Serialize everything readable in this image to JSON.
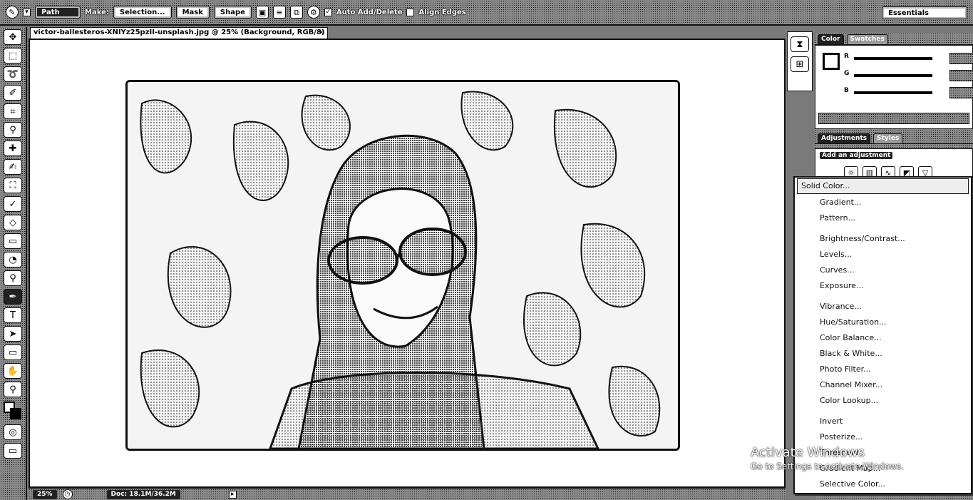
{
  "options_bar": {
    "mode_selected": "Path",
    "make_label": "Make:",
    "selection_button": "Selection...",
    "mask_button": "Mask",
    "shape_button": "Shape",
    "auto_add_delete": "Auto Add/Delete",
    "auto_add_delete_checked": true,
    "align_edges": "Align Edges",
    "align_edges_checked": false,
    "workspace": "Essentials"
  },
  "document": {
    "tab_title": "victor-ballesteros-XNIYz25pzII-unsplash.jpg @ 25% (Background, RGB/8)",
    "close": "×"
  },
  "status_bar": {
    "zoom": "25%",
    "doc_size": "Doc: 18.1M/36.2M"
  },
  "color_panel": {
    "tabs": [
      "Color",
      "Swatches"
    ],
    "channels": [
      "R",
      "G",
      "B"
    ]
  },
  "adjustments_panel": {
    "tabs": [
      "Adjustments",
      "Styles"
    ],
    "add_label": "Add an adjustment"
  },
  "dropdown": {
    "items": [
      "Solid Color...",
      "Gradient...",
      "Pattern...",
      "Brightness/Contrast...",
      "Levels...",
      "Curves...",
      "Exposure...",
      "Vibrance...",
      "Hue/Saturation...",
      "Color Balance...",
      "Black & White...",
      "Photo Filter...",
      "Channel Mixer...",
      "Color Lookup...",
      "Invert",
      "Posterize...",
      "Threshold",
      "Gradient Map...",
      "Selective Color..."
    ],
    "selected": "Solid Color..."
  },
  "watermark": {
    "line1": "Activate Windows",
    "line2": "Go to Settings to activate Windows."
  },
  "colors": {
    "ink": "#111111",
    "menu_bg": "#ffffff",
    "chrome": "#8c8c8c"
  }
}
